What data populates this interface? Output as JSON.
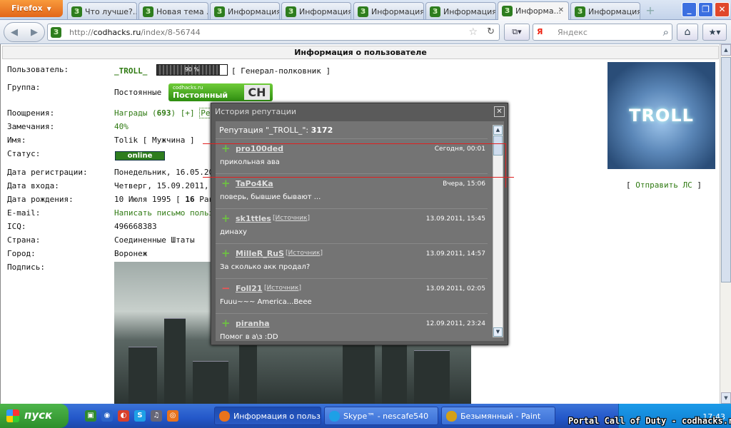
{
  "browser": {
    "menu_label": "Firefox",
    "tabs": [
      {
        "label": "Что лучше?..."
      },
      {
        "label": "Новая тема ..."
      },
      {
        "label": "Информация..."
      },
      {
        "label": "Информация..."
      },
      {
        "label": "Информация..."
      },
      {
        "label": "Информация..."
      },
      {
        "label": "Информа..."
      },
      {
        "label": "Информация..."
      }
    ],
    "url_prefix": "http://",
    "url_domain": "codhacks.ru",
    "url_path": "/index/8-56744",
    "search_engine": "Я",
    "search_placeholder": "Яндекс"
  },
  "page": {
    "header": "Информация о пользователе",
    "labels": {
      "user": "Пользователь:",
      "group": "Группа:",
      "rewards": "Поощрения:",
      "warnings": "Замечания:",
      "name": "Имя:",
      "status": "Статус:",
      "reg_date": "Дата регистрации:",
      "login_date": "Дата входа:",
      "birth_date": "Дата рождения:",
      "email": "E-mail:",
      "icq": "ICQ:",
      "country": "Страна:",
      "city": "Город:",
      "signature": "Подпись:"
    },
    "username": "_TROLL_",
    "progress_text": "90 %",
    "progress_value": 0.9,
    "rank": "[ Генерал-полковник ]",
    "group_value": "Постоянные",
    "group_badge_sub": "codhacks.ru",
    "group_badge_main": "Постоянный",
    "group_badge_logo": "CH",
    "rewards_text": "Награды",
    "rewards_count": "693",
    "rewards_plus": "[+]",
    "rewards_extra": "Ре",
    "warnings_value": "40%",
    "name_value": "Tolik [ Мужчина ]",
    "status_value": "online",
    "reg_date_value": "Понедельник, 16.05.20",
    "login_date_value": "Четверг, 15.09.2011, 17",
    "birth_date_prefix": "10 Июля 1995 [",
    "birth_age": "16",
    "birth_suffix": "Рак",
    "email_value": "Написать письмо польз",
    "icq_value": "496668383",
    "country_value": "Соединенные Штаты",
    "city_value": "Воронеж",
    "avatar_text": "TROLL",
    "send_pm_open": "[ ",
    "send_pm": "Отправить ЛС",
    "send_pm_close": " ]"
  },
  "popup": {
    "title": "История репутации",
    "total_label": "Репутация \"_TROLL_\":",
    "total_value": "3172",
    "entries": [
      {
        "sign": "plus",
        "user": "pro100ded",
        "source": "",
        "date": "Сегодня, 00:01",
        "message": "прикольная ава"
      },
      {
        "sign": "plus",
        "user": "TaPo4Ka",
        "source": "",
        "date": "Вчера, 15:06",
        "message": "поверь, бывшие бывают ..."
      },
      {
        "sign": "plus",
        "user": "sk1ttles",
        "source": "Источник",
        "date": "13.09.2011, 15:45",
        "message": "динаху"
      },
      {
        "sign": "plus",
        "user": "MilleR_RuS",
        "source": "Источник",
        "date": "13.09.2011, 14:57",
        "message": "За сколько акк продал?"
      },
      {
        "sign": "minus",
        "user": "Foll21",
        "source": "Источник",
        "date": "13.09.2011, 02:05",
        "message": "Fuuu~~~ America...Beee"
      },
      {
        "sign": "plus",
        "user": "piranha",
        "source": "",
        "date": "12.09.2011, 23:24",
        "message": "Помог в а\\з :DD"
      }
    ]
  },
  "taskbar": {
    "start_label": "пуск",
    "tasks": [
      {
        "label": "Информация о польз...",
        "color": "#e8731c"
      },
      {
        "label": "Skype™ - nescafe540",
        "color": "#1ea0e6"
      },
      {
        "label": "Безымянный - Paint",
        "color": "#d4a017"
      }
    ],
    "clock": "17:43"
  },
  "watermark": "Portal Call of Duty - codhacks.ru",
  "colors": {
    "accent_green": "#2f7a12",
    "popup_bg": "#5a5a5a",
    "plus_sign": "#6ec043",
    "minus_sign": "#e55555"
  }
}
